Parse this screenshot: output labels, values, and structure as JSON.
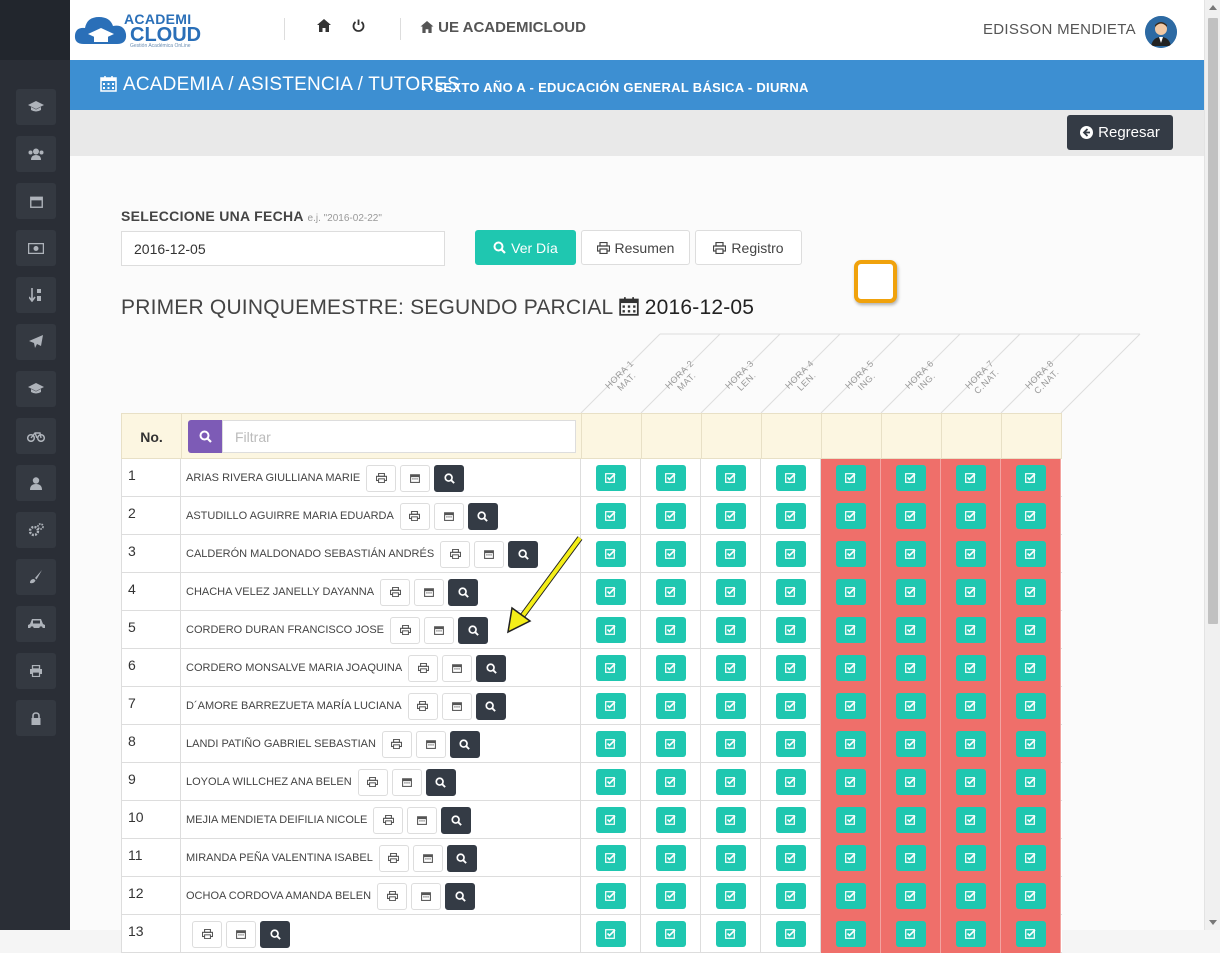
{
  "app": {
    "logo_line1": "ACADEMI",
    "logo_line2": "CLOUD",
    "logo_tagline": "Gestión Académica OnLine",
    "brand": "UE ACADEMICLOUD",
    "user_name": "EDISSON MENDIETA"
  },
  "breadcrumb": {
    "path": "ACADEMIA / ASISTENCIA / TUTORES",
    "current": "SEXTO AÑO A - EDUCACIÓN GENERAL BÁSICA - DIURNA"
  },
  "actions": {
    "back_label": "Regresar"
  },
  "date_picker": {
    "label": "SELECCIONE UNA FECHA",
    "example": "e.j. \"2016-02-22\"",
    "value": "2016-12-05"
  },
  "buttons": {
    "ver_dia": "Ver Día",
    "resumen": "Resumen",
    "registro": "Registro"
  },
  "period": {
    "title": "PRIMER QUINQUEMESTRE: SEGUNDO PARCIAL",
    "date": "2016-12-05"
  },
  "table": {
    "no_header": "No.",
    "filter_placeholder": "Filtrar",
    "hours": [
      {
        "line1": "HORA 1",
        "line2": "MAT.",
        "status": "present"
      },
      {
        "line1": "HORA 2",
        "line2": "MAT.",
        "status": "present"
      },
      {
        "line1": "HORA 3",
        "line2": "LEN.",
        "status": "present"
      },
      {
        "line1": "HORA 4",
        "line2": "LEN.",
        "status": "present"
      },
      {
        "line1": "HORA 5",
        "line2": "ING.",
        "status": "absent"
      },
      {
        "line1": "HORA 6",
        "line2": "ING.",
        "status": "absent"
      },
      {
        "line1": "HORA 7",
        "line2": "C.NAT.",
        "status": "absent"
      },
      {
        "line1": "HORA 8",
        "line2": "C.NAT.",
        "status": "absent"
      }
    ],
    "students": [
      {
        "no": "1",
        "name": "ARIAS RIVERA GIULLIANA MARIE"
      },
      {
        "no": "2",
        "name": "ASTUDILLO AGUIRRE MARIA EDUARDA"
      },
      {
        "no": "3",
        "name": "CALDERÓN MALDONADO SEBASTIÁN ANDRÉS"
      },
      {
        "no": "4",
        "name": "CHACHA VELEZ JANELLY DAYANNA"
      },
      {
        "no": "5",
        "name": "CORDERO DURAN FRANCISCO JOSE"
      },
      {
        "no": "6",
        "name": "CORDERO MONSALVE MARIA JOAQUINA"
      },
      {
        "no": "7",
        "name": "D´AMORE BARREZUETA MARÍA LUCIANA"
      },
      {
        "no": "8",
        "name": "LANDI PATIÑO GABRIEL SEBASTIAN"
      },
      {
        "no": "9",
        "name": "LOYOLA WILLCHEZ ANA BELEN"
      },
      {
        "no": "10",
        "name": "MEJIA MENDIETA DEIFILIA NICOLE"
      },
      {
        "no": "11",
        "name": "MIRANDA PEÑA VALENTINA ISABEL"
      },
      {
        "no": "12",
        "name": "OCHOA CORDOVA AMANDA BELEN"
      },
      {
        "no": "13",
        "name": ""
      }
    ]
  },
  "colors": {
    "sidebar": "#2a2e36",
    "header_blue": "#3d8fd2",
    "teal": "#1fc7b0",
    "absent_red": "#ef6f6a",
    "dark_button": "#343b45",
    "filter_purple": "#7d5bb6",
    "highlight_orange": "#f0a20c",
    "annotation_yellow": "#f4ee18"
  },
  "icons": {
    "sidebar": [
      "graduation-cap-icon",
      "users-icon",
      "calendar-icon",
      "money-icon",
      "sort-icon",
      "paper-plane-icon",
      "graduation-cap-icon",
      "bicycle-icon",
      "user-icon",
      "cogs-icon",
      "paint-brush-icon",
      "car-icon",
      "print-icon",
      "lock-icon"
    ]
  }
}
